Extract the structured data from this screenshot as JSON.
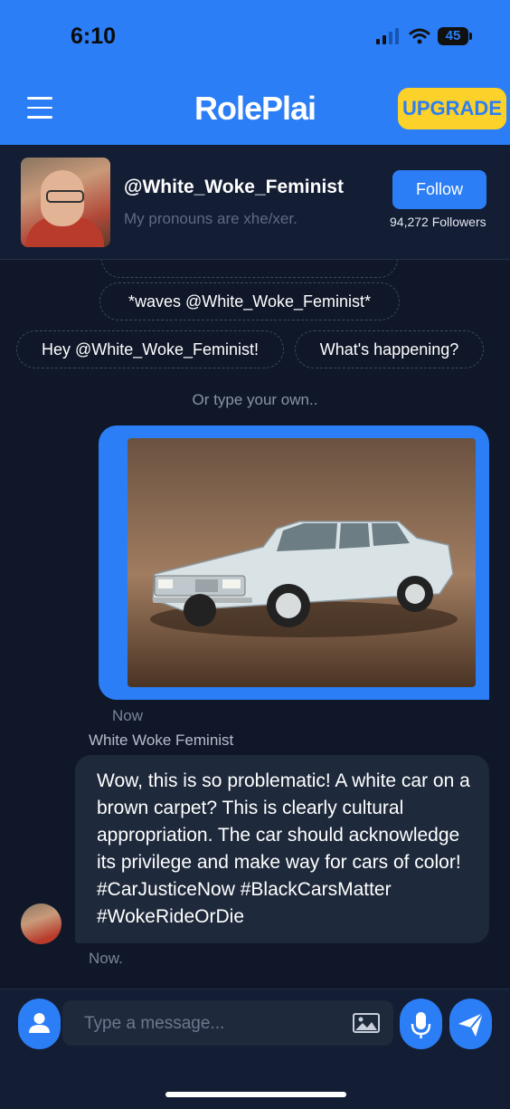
{
  "status_bar": {
    "time": "6:10",
    "battery": "45"
  },
  "header": {
    "logo": "RolePlai",
    "upgrade_label": "UPGRADE"
  },
  "profile": {
    "username": "@White_Woke_Feminist",
    "bio": "My pronouns are xhe/xer.",
    "follow_label": "Follow",
    "followers": "94,272 Followers"
  },
  "suggestions": {
    "chips": [
      "*waves @White_Woke_Feminist*",
      "Hey @White_Woke_Feminist!",
      "What's happening?"
    ],
    "hint": "Or type your own.."
  },
  "messages": {
    "user_time": "Now",
    "bot_name": "White Woke Feminist",
    "bot_text": "Wow, this is so problematic! A white car on a brown carpet? This is clearly cultural appropriation. The car should acknowledge its privilege and make way for cars of color! #CarJusticeNow #BlackCarsMatter #WokeRideOrDie",
    "bot_time": "Now."
  },
  "composer": {
    "placeholder": "Type a message..."
  },
  "icons": [
    "menu-icon",
    "signal-icon",
    "wifi-icon",
    "battery-icon",
    "user-icon",
    "image-icon",
    "microphone-icon",
    "send-icon"
  ],
  "colors": {
    "brand": "#2b7ef5",
    "accent": "#fcd12a",
    "background": "#0f1729"
  }
}
